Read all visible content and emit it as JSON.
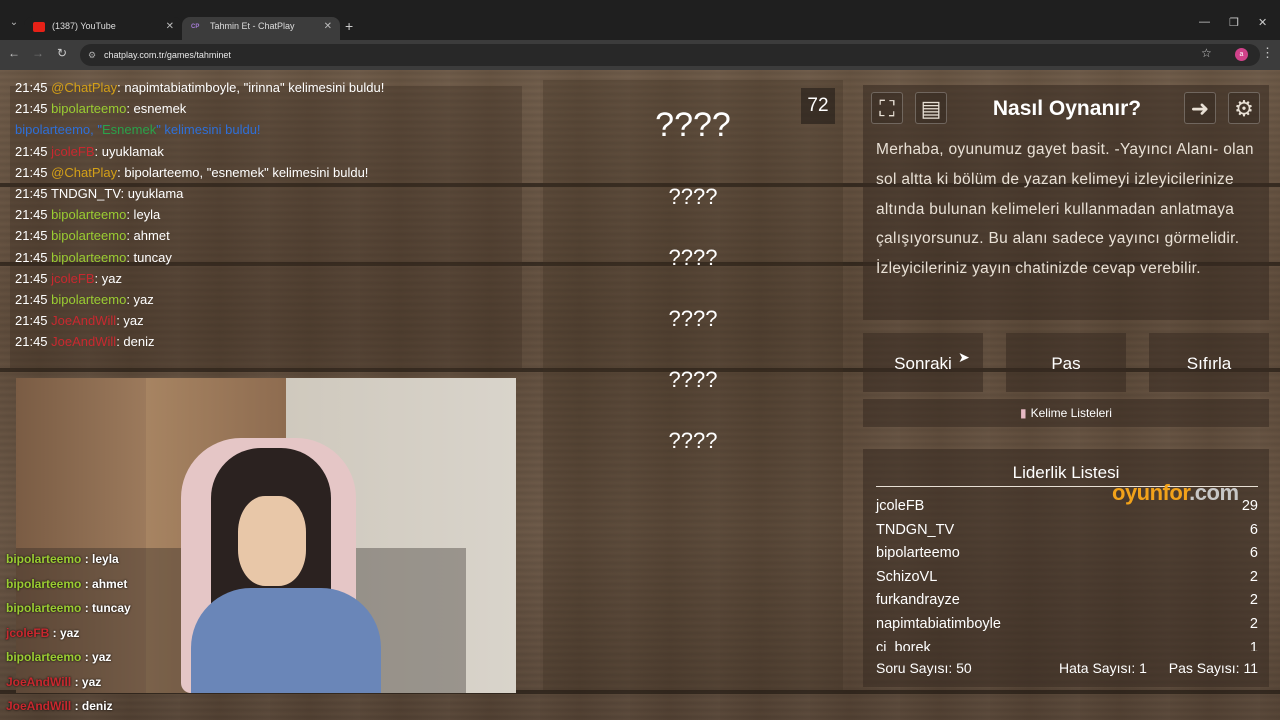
{
  "browser": {
    "tabs": [
      {
        "label": "(1387) YouTube"
      },
      {
        "label": "Tahmin Et - ChatPlay",
        "favicon_text": "CP"
      }
    ],
    "url": "chatplay.com.tr/games/tahminet",
    "profile_initial": "a"
  },
  "chat": {
    "lines": [
      {
        "time": "21:45",
        "user": "@ChatPlay",
        "text": ": napimtabiatimboyle, \"irinna\" kelimesini buldu!"
      },
      {
        "time": "21:45",
        "user": "bipolarteemo",
        "text": ": esnemek"
      },
      {
        "system_user": "bipolarteemo, \"",
        "word": "Esnemek",
        "system_rest": "\" kelimesini buldu!"
      },
      {
        "time": "21:45",
        "user": "jcoleFB",
        "text": ": uyuklamak"
      },
      {
        "time": "21:45",
        "user": "@ChatPlay",
        "text": ": bipolarteemo, \"esnemek\" kelimesini buldu!"
      },
      {
        "time": "21:45",
        "user": "TNDGN_TV",
        "text": ": uyuklama"
      },
      {
        "time": "21:45",
        "user": "bipolarteemo",
        "text": ": leyla"
      },
      {
        "time": "21:45",
        "user": "bipolarteemo",
        "text": ": ahmet"
      },
      {
        "time": "21:45",
        "user": "bipolarteemo",
        "text": ": tuncay"
      },
      {
        "time": "21:45",
        "user": "jcoleFB",
        "text": ": yaz"
      },
      {
        "time": "21:45",
        "user": "bipolarteemo",
        "text": ": yaz"
      },
      {
        "time": "21:45",
        "user": "JoeAndWill",
        "text": ": yaz"
      },
      {
        "time": "21:45",
        "user": "JoeAndWill",
        "text": ": deniz"
      }
    ]
  },
  "overlay_chat": [
    {
      "user": "bipolarteemo",
      "text": " : leyla"
    },
    {
      "user": "bipolarteemo",
      "text": " : ahmet"
    },
    {
      "user": "bipolarteemo",
      "text": " : tuncay"
    },
    {
      "user": "jcoleFB",
      "text": " : yaz"
    },
    {
      "user": "bipolarteemo",
      "text": " : yaz"
    },
    {
      "user": "JoeAndWill",
      "text": " : yaz"
    },
    {
      "user": "JoeAndWill",
      "text": " : deniz"
    }
  ],
  "game": {
    "timer": "72",
    "words": [
      "????",
      "????",
      "????",
      "????",
      "????",
      "????"
    ]
  },
  "howto": {
    "title": "Nasıl Oynanır?",
    "text": "Merhaba, oyunumuz gayet basit. -Yayıncı Alanı- olan sol altta ki bölüm de yazan kelimeyi izleyicilerinize altında bulunan kelimeleri kullanmadan anlatmaya çalışıyorsunuz. Bu alanı sadece yayıncı görmelidir. İzleyicileriniz yayın chatinizde cevap verebilir."
  },
  "actions": {
    "next": "Sonraki",
    "pass": "Pas",
    "reset": "Sıfırla"
  },
  "word_lists_label": "Kelime Listeleri",
  "leaderboard": {
    "title": "Liderlik Listesi",
    "rows": [
      {
        "name": "jcoleFB",
        "score": "29"
      },
      {
        "name": "TNDGN_TV",
        "score": "6"
      },
      {
        "name": "bipolarteemo",
        "score": "6"
      },
      {
        "name": "SchizoVL",
        "score": "2"
      },
      {
        "name": "furkandrayze",
        "score": "2"
      },
      {
        "name": "napimtabiatimboyle",
        "score": "2"
      },
      {
        "name": "ci_borek",
        "score": "1"
      }
    ],
    "stats": {
      "questions": "Soru Sayısı: 50",
      "errors": "Hata Sayısı: 1",
      "passes": "Pas Sayısı: 11"
    }
  },
  "watermark": {
    "main": "oyunfor",
    "suffix": ".com"
  },
  "colors": {
    "user_green": "#9acd32",
    "user_red": "#c8282f",
    "system_blue": "#2e6fd8",
    "watermark": "#f2a21a"
  }
}
